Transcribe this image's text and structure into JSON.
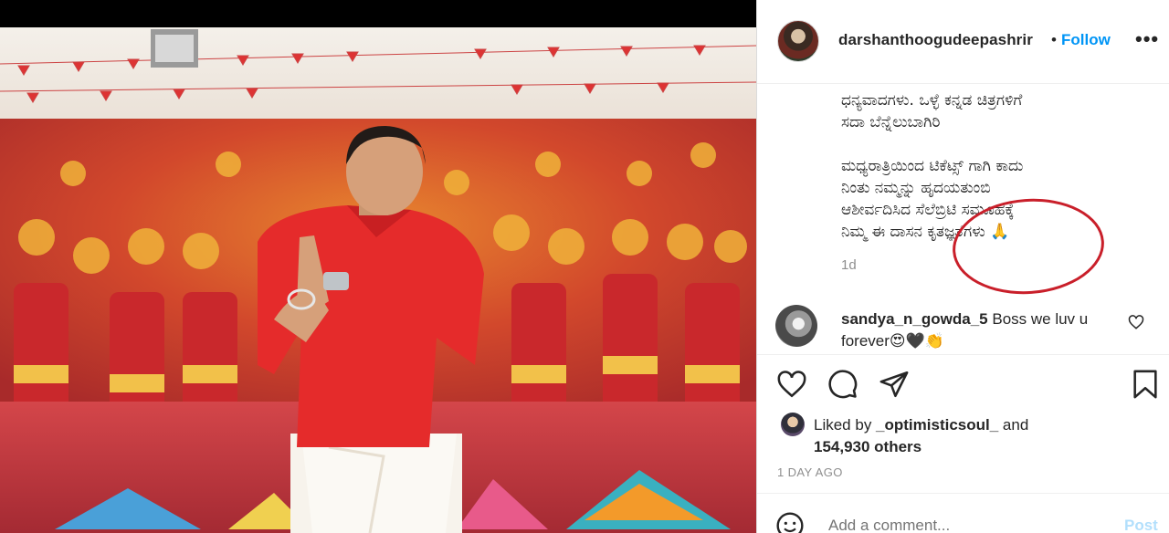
{
  "post": {
    "username": "darshanthoogudeepashrir",
    "follow_label": "Follow",
    "separator": "•",
    "more_label": "•••",
    "caption_paragraphs": [
      "ಧನ್ಯವಾದಗಳು. ಒಳ್ಳೆ ಕನ್ನಡ ಚಿತ್ರಗಳಿಗೆ\nಸದಾ ಬೆನ್ನೆಲುಬಾಗಿರಿ",
      "ಮಧ್ಯರಾತ್ರಿಯಿಂದ ಟಿಕೆಟ್ಸ್ ಗಾಗಿ ಕಾದು\nನಿಂತು ನಮ್ಮನ್ನು ಹೃದಯತುಂಬಿ\nಆಶೀರ್ವದಿಸಿದ ಸೆಲೆಬ್ರಿಟಿ ಸಮೂಹಕ್ಕೆ\nನಿಮ್ಮ ಈ ದಾಸನ ಕೃತಜ್ಞತೆಗಳು 🙏"
    ],
    "caption_age": "1d",
    "comment": {
      "username": "sandya_n_gowda_5",
      "text": "Boss we luv u forever😍🖤👏"
    },
    "likes": {
      "prefix": "Liked by ",
      "user": "_optimisticsoul_",
      "middle": " and",
      "count_text": "154,930 others"
    },
    "time_ago": "1 DAY AGO",
    "add_comment_placeholder": "Add a comment...",
    "post_label": "Post"
  },
  "icons": {
    "like": "heart-icon",
    "comment": "comment-bubble-icon",
    "share": "paper-plane-icon",
    "save": "bookmark-icon",
    "emoji": "smiley-icon"
  },
  "colors": {
    "follow_blue": "#0095f6",
    "annotation_circle": "#c91f2a",
    "post_disabled": "#b2dffc",
    "shirt_red": "#e52b2b"
  }
}
